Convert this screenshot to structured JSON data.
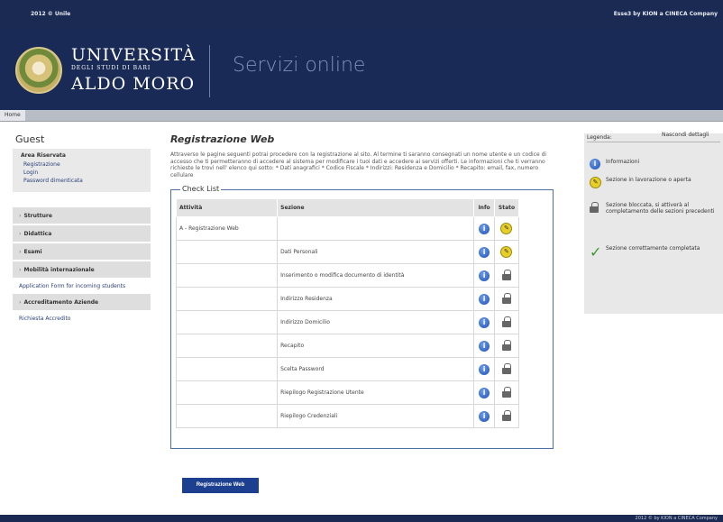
{
  "topbar": {
    "left": "2012 © Unile",
    "right": "Esse3 by KION a CINECA Company"
  },
  "header": {
    "brand_line1": "UNIVERSITÀ",
    "brand_line2": "DEGLI STUDI DI BARI",
    "brand_line3": "ALDO MORO",
    "service_title": "Servizi online"
  },
  "nav": {
    "home": "Home"
  },
  "sidebar": {
    "user": "Guest",
    "panel_title": "Area Riservata",
    "panel_links": [
      "Registrazione",
      "Login",
      "Password dimenticata"
    ],
    "menu": [
      "Strutture",
      "Didattica",
      "Esami",
      "Mobilità internazionale"
    ],
    "mobility_sub": "Application Form for incoming students",
    "company_menu": "Accreditamento Aziende",
    "company_sub": "Richiesta Accredito"
  },
  "main": {
    "title": "Registrazione Web",
    "intro": "Attraverso le pagine seguenti potrai procedere con la registrazione al sito. Al termine ti saranno consegnati un nome utente e un codice di accesso che ti permetteranno di accedere al sistema per modificare i tuoi dati e accedere ai servizi offerti. Le informazioni che ti verranno richieste le trovi nell' elenco qui sotto: * Dati anagrafici * Codice Fiscale * Indirizzi: Residenza e Domicilio * Recapito: email, fax, numero cellulare",
    "checklist_title": "Check List",
    "columns": {
      "attivita": "Attività",
      "sezione": "Sezione",
      "info": "Info",
      "stato": "Stato"
    },
    "rows": [
      {
        "attivita": "A - Registrazione Web",
        "sezione": "",
        "stato": "work"
      },
      {
        "attivita": "",
        "sezione": "Dati Personali",
        "stato": "work"
      },
      {
        "attivita": "",
        "sezione": "Inserimento o modifica documento di identità",
        "stato": "lock"
      },
      {
        "attivita": "",
        "sezione": "Indirizzo Residenza",
        "stato": "lock"
      },
      {
        "attivita": "",
        "sezione": "Indirizzo Domicilio",
        "stato": "lock"
      },
      {
        "attivita": "",
        "sezione": "Recapito",
        "stato": "lock"
      },
      {
        "attivita": "",
        "sezione": "Scelta Password",
        "stato": "lock"
      },
      {
        "attivita": "",
        "sezione": "Riepilogo Registrazione Utente",
        "stato": "lock"
      },
      {
        "attivita": "",
        "sezione": "Riepilogo Credenziali",
        "stato": "lock"
      }
    ],
    "button": "Registrazione Web"
  },
  "legend": {
    "title": "Legenda:",
    "hide_link": "Nascondi dettagli",
    "items": [
      {
        "icon": "info-icon",
        "text": "Informazioni"
      },
      {
        "icon": "in-progress-icon",
        "text": "Sezione in lavorazione o aperta"
      },
      {
        "icon": "lock-icon",
        "text": "Sezione bloccata, si attiverà al completamento delle sezioni precedenti"
      },
      {
        "icon": "check-icon",
        "text": "Sezione correttamente completata"
      }
    ]
  },
  "footer": {
    "right": "2012 © by KION a CINECA Company"
  }
}
